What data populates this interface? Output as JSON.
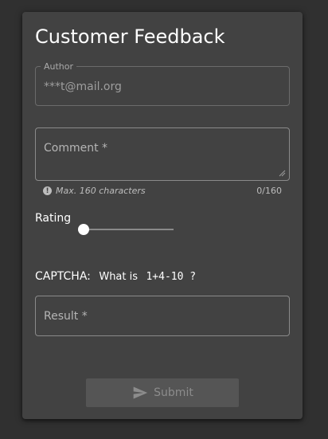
{
  "form": {
    "title": "Customer Feedback",
    "author": {
      "label": "Author",
      "value": "***t@mail.org"
    },
    "comment": {
      "placeholder": "Comment *",
      "hint": "Max. 160 characters",
      "counter": "0/160"
    },
    "rating": {
      "label": "Rating",
      "value": 0
    },
    "captcha": {
      "label": "CAPTCHA:",
      "question": "What is",
      "expression": "1+4-10",
      "suffix": "?"
    },
    "result": {
      "placeholder": "Result *"
    },
    "submit": {
      "label": "Submit",
      "icon": "send-icon"
    }
  },
  "colors": {
    "background": "#303030",
    "card": "#424242",
    "text": "#ffffff",
    "muted": "#9e9e9e"
  }
}
